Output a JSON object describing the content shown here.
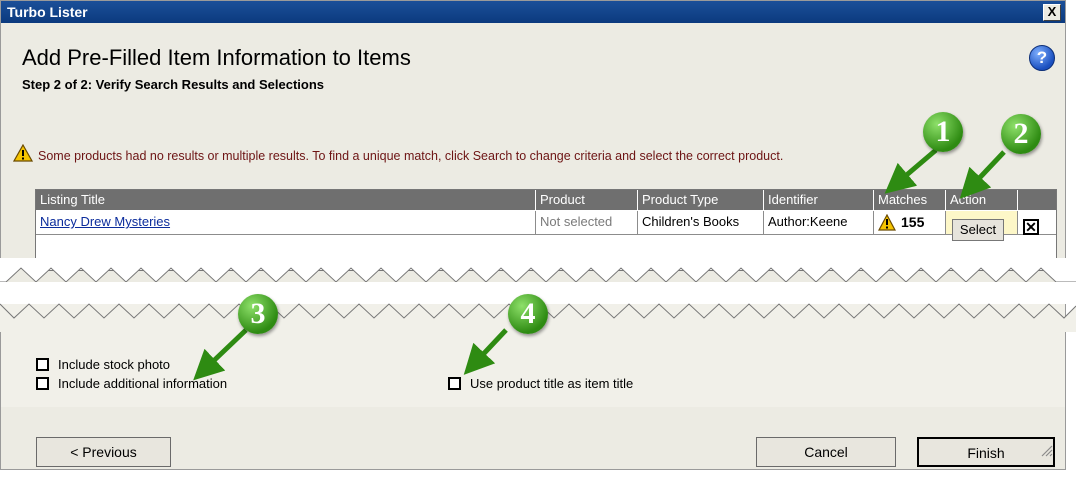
{
  "window": {
    "title": "Turbo Lister",
    "close_label": "X"
  },
  "header": {
    "title": "Add Pre-Filled Item Information to Items",
    "subtitle": "Step 2 of 2: Verify Search Results and Selections",
    "help_label": "?"
  },
  "warning": {
    "message": "Some products had no results or multiple results. To find a unique match, click Search to change criteria and select the correct product."
  },
  "table": {
    "columns": [
      "Listing Title",
      "Product",
      "Product Type",
      "Identifier",
      "Matches",
      "Action"
    ],
    "rows": [
      {
        "listing_title": "Nancy Drew Mysteries",
        "product": "Not selected",
        "product_type": "Children's Books",
        "identifier": "Author:Keene",
        "matches": "155",
        "action": "Select"
      }
    ]
  },
  "options": {
    "stock_photo": "Include stock photo",
    "additional_info": "Include additional information",
    "product_title": "Use product title as item title"
  },
  "buttons": {
    "previous": "< Previous",
    "cancel": "Cancel",
    "finish": "Finish"
  },
  "callouts": [
    "1",
    "2",
    "3",
    "4"
  ],
  "colors": {
    "titlebar": "#0b3a7e",
    "badge_green": "#2e8b12",
    "warning_text": "#6d1414",
    "header_gray": "#6f6f6f",
    "link": "#0b2c9c"
  }
}
